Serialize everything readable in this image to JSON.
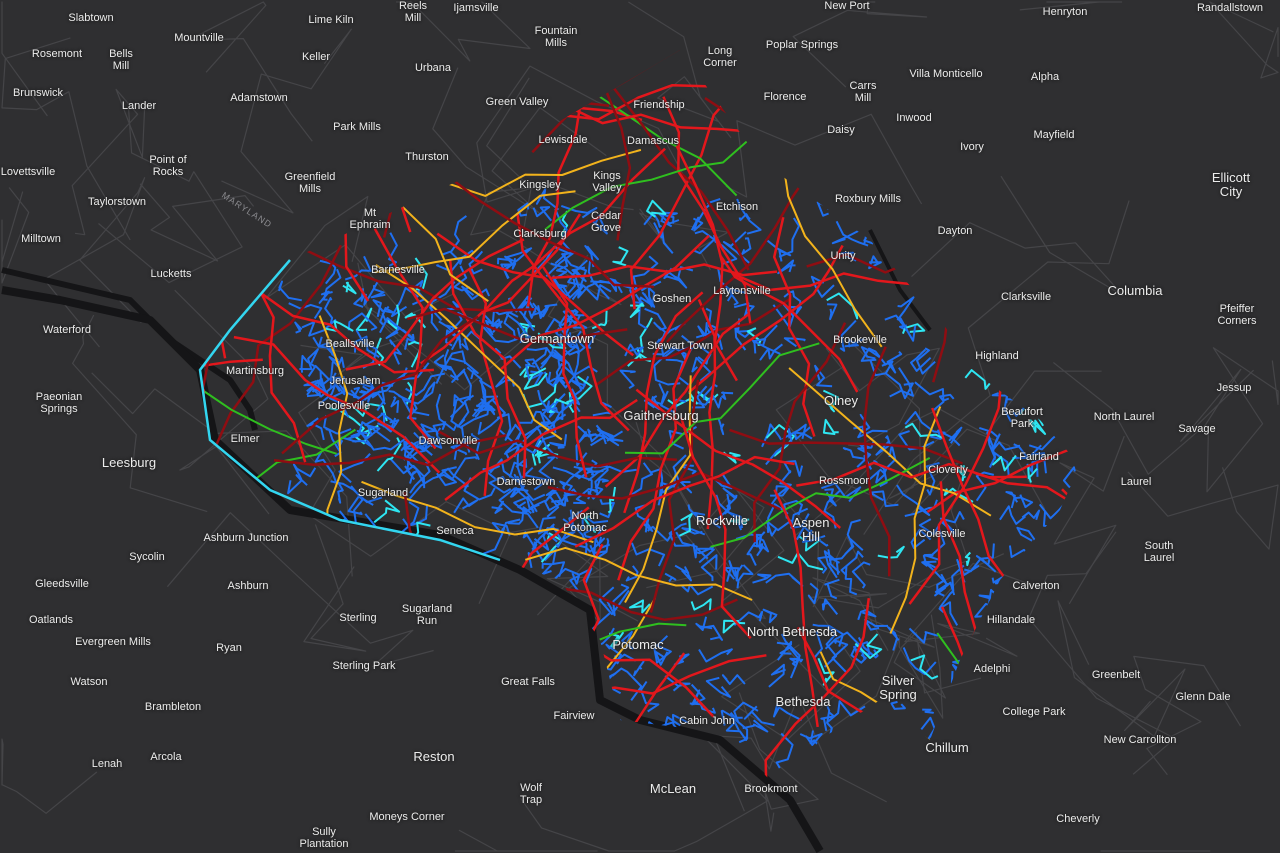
{
  "map": {
    "state_label": "MARYLAND",
    "colors": {
      "background": "#2f2f31",
      "county_boundary": "#33d6f0",
      "river": "#151517",
      "road_major": "#e3171c",
      "road_dark": "#8f0d12",
      "road_collector": "#f2b31c",
      "road_green": "#2fbf1f",
      "road_local": "#1f6ff0",
      "road_cyan": "#2ee6f2",
      "road_yellow": "#ffe600"
    },
    "places": [
      "Slabtown",
      "Mountville",
      "Rosemont",
      "Bells\nMill",
      "Lime Kiln",
      "Reels\nMill",
      "Ijamsville",
      "Fountain\nMills",
      "Keller",
      "Urbana",
      "Brunswick",
      "Lander",
      "Adamstown",
      "Green Valley",
      "Park Mills",
      "Point of\nRocks",
      "Thurston",
      "Lovettsville",
      "Greenfield\nMills",
      "Taylorstown",
      "Mt\nEphraim",
      "Milltown",
      "Lucketts",
      "Barnesville",
      "Lewisdale",
      "Damascus",
      "Friendship",
      "Kingsley",
      "Kings\nValley",
      "Cedar\nGrove",
      "Clarksburg",
      "Long\nCorner",
      "New Port",
      "Henryton",
      "Poplar Springs",
      "Villa Monticello",
      "Alpha",
      "Florence",
      "Carrs\nMill",
      "Inwood",
      "Daisy",
      "Mayfield",
      "Ivory",
      "Ellicott\nCity",
      "Etchison",
      "Roxbury Mills",
      "Dayton",
      "Unity",
      "Laytonsville",
      "Goshen",
      "Clarksville",
      "Columbia",
      "Pfeiffer\nCorners",
      "Germantown",
      "Stewart Town",
      "Brookeville",
      "Highland",
      "Beallsville",
      "Martinsburg",
      "Jerusalem",
      "Poolesville",
      "Olney",
      "Jessup",
      "Paeonian\nSprings",
      "Waterford",
      "Gaithersburg",
      "Beaufort\nPark",
      "North Laurel",
      "Savage",
      "Elmer",
      "Dawsonville",
      "Leesburg",
      "Cloverly",
      "Fairland",
      "Laurel",
      "Darnestown",
      "Rossmoor",
      "Sugarland",
      "North\nPotomac",
      "Rockville",
      "Aspen\nHill",
      "Colesville",
      "Seneca",
      "Ashburn Junction",
      "South\nLaurel",
      "Sycolin",
      "Gleedsville",
      "Ashburn",
      "Calverton",
      "Oatlands",
      "Sterling",
      "Sugarland\nRun",
      "Hillandale",
      "Evergreen Mills",
      "Ryan",
      "Potomac",
      "North Bethesda",
      "Adelphi",
      "Sterling Park",
      "Watson",
      "Great Falls",
      "Greenbelt",
      "Silver\nSpring",
      "Glenn Dale",
      "Brambleton",
      "Bethesda",
      "Fairview",
      "College Park",
      "Cabin John",
      "Chillum",
      "Reston",
      "Lenah",
      "Arcola",
      "New Carrollton",
      "McLean",
      "Wolf\nTrap",
      "Brookmont",
      "Moneys Corner",
      "Sully\nPlantation",
      "Cheverly",
      "Randallstown"
    ]
  }
}
